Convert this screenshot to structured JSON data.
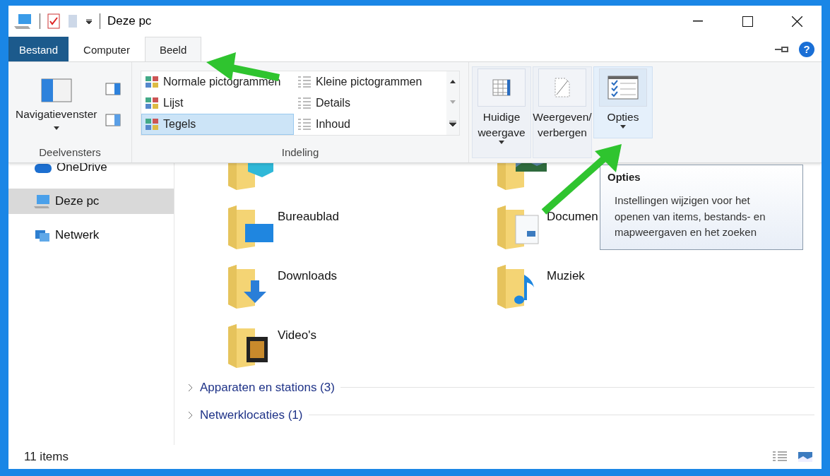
{
  "window": {
    "title": "Deze pc"
  },
  "tabs": [
    {
      "label": "Bestand",
      "kind": "file",
      "selected": false
    },
    {
      "label": "Computer",
      "kind": "tab",
      "selected": false
    },
    {
      "label": "Beeld",
      "kind": "tab",
      "selected": true
    }
  ],
  "help": "?",
  "ribbon": {
    "panes": {
      "button": "Navigatievenster",
      "label": "Deelvensters"
    },
    "layout": {
      "label": "Indeling",
      "items": [
        {
          "label": "Normale pictogrammen",
          "selected": false
        },
        {
          "label": "Kleine pictogrammen",
          "selected": false
        },
        {
          "label": "Lijst",
          "selected": false
        },
        {
          "label": "Details",
          "selected": false
        },
        {
          "label": "Tegels",
          "selected": true
        },
        {
          "label": "Inhoud",
          "selected": false
        }
      ]
    },
    "views": [
      {
        "label": "Huidige weergave",
        "kind": "grid",
        "highlighted": false
      },
      {
        "label": "Weergeven/ verbergen",
        "kind": "page",
        "highlighted": false
      },
      {
        "label": "Opties",
        "kind": "options",
        "highlighted": true
      }
    ]
  },
  "sidebar": {
    "items": [
      {
        "label": "OneDrive",
        "kind": "cloud",
        "selected": false
      },
      {
        "label": "Deze pc",
        "kind": "pc",
        "selected": true
      },
      {
        "label": "Netwerk",
        "kind": "network",
        "selected": false
      }
    ]
  },
  "folders": [
    {
      "kind": "cube"
    },
    {
      "kind": "pictures"
    },
    {
      "label": "Bureaublad",
      "kind": "desktop"
    },
    {
      "label": "Documen",
      "kind": "documents"
    },
    {
      "label": "Downloads",
      "kind": "downloads"
    },
    {
      "label": "Muziek",
      "kind": "music"
    },
    {
      "label": "Video's",
      "kind": "videos"
    }
  ],
  "groups": [
    {
      "label": "Apparaten en stations (3)",
      "expanded": false
    },
    {
      "label": "Netwerklocaties (1)",
      "expanded": false
    }
  ],
  "tooltip": {
    "title": "Opties",
    "text": "Instellingen wijzigen voor het openen van items, bestands- en mapweergaven en het zoeken"
  },
  "status_bar": {
    "count": "11 items"
  }
}
